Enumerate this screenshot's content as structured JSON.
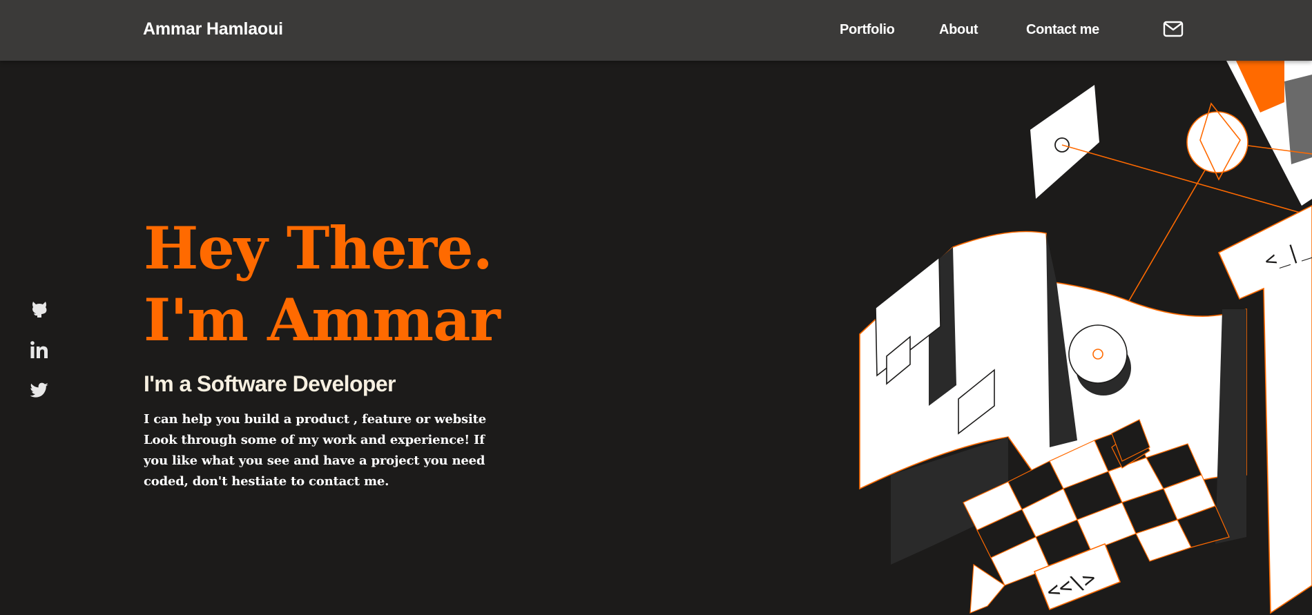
{
  "header": {
    "brand": "Ammar Hamlaoui",
    "nav": {
      "portfolio": "Portfolio",
      "about": "About",
      "contact": "Contact me"
    },
    "mail_icon": "mail-icon"
  },
  "social": [
    {
      "icon": "github-icon"
    },
    {
      "icon": "linkedin-icon"
    },
    {
      "icon": "twitter-icon"
    }
  ],
  "hero": {
    "greeting": "Hey There.",
    "name_line": "I'm Ammar",
    "subtitle": "I'm a Software Developer",
    "description": "I can help you build a product , feature or website Look through some of my work and experience! If you like what you see and have a project you need coded, don't hestiate to contact me."
  },
  "illustration": {
    "code_tag_1": "<_|_",
    "code_tag_2": "<<\\>"
  },
  "colors": {
    "background": "#1c1b1a",
    "navbar": "#3b3a39",
    "accent": "#ff6a00",
    "subtitle": "#f7f0e1",
    "text": "#ffffff"
  }
}
